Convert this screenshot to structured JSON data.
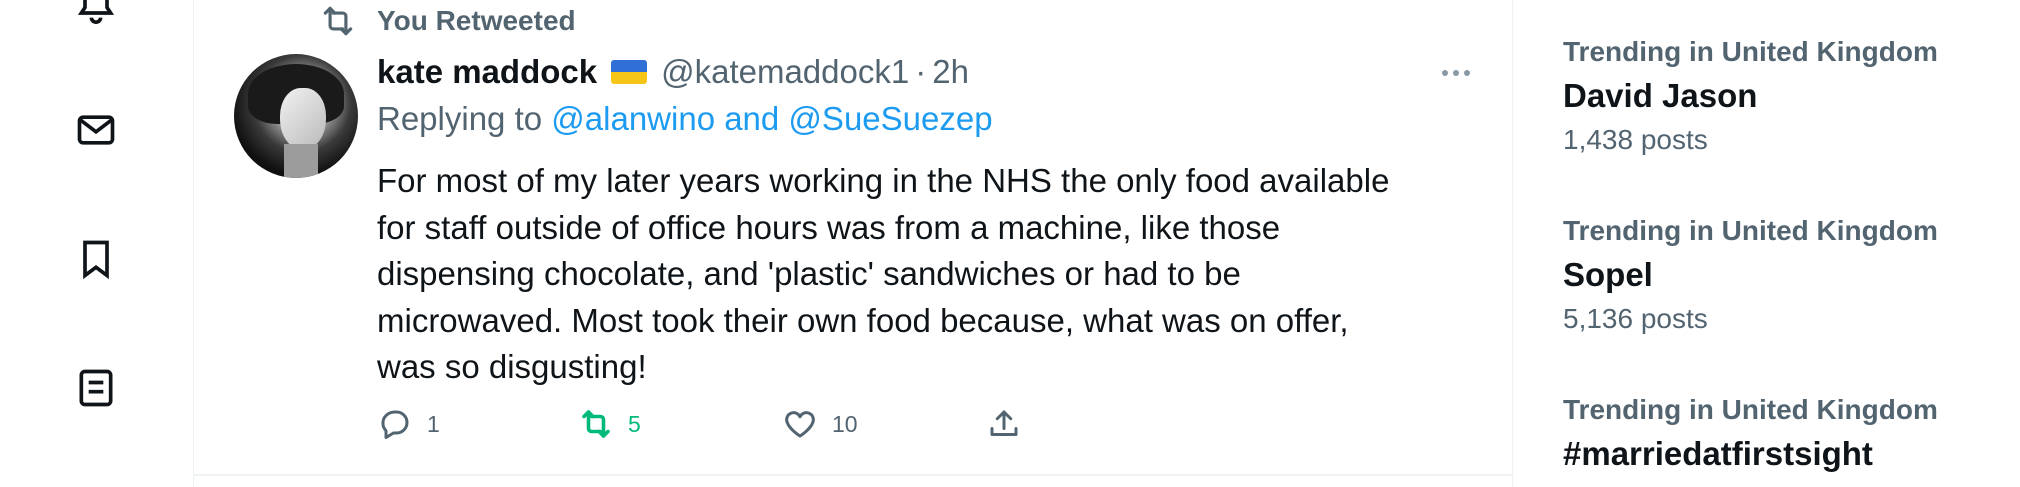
{
  "nav": {
    "icons": [
      "notifications-icon",
      "messages-icon",
      "bookmarks-icon",
      "lists-icon"
    ]
  },
  "tweet": {
    "social_context": "You Retweeted",
    "author_name": "kate maddock",
    "author_flag": "ukraine-flag",
    "handle": "@katemaddock1",
    "separator": "·",
    "time": "2h",
    "replying_prefix": "Replying to",
    "replying_to": "@alanwino and @SueSuezep",
    "text_lines": [
      "For most of my later years working in the NHS the only food available",
      "for staff outside of office hours was from a machine, like those",
      "dispensing chocolate, and 'plastic' sandwiches or had to be",
      "microwaved. Most took their own food because, what was on offer,",
      "was so disgusting!"
    ],
    "actions": {
      "reply_count": "1",
      "retweet_count": "5",
      "like_count": "10"
    },
    "colors": {
      "retweet_active": "#00ba7c",
      "link": "#1d9bf0",
      "secondary_text": "#536471"
    }
  },
  "trends": [
    {
      "context": "Trending in United Kingdom",
      "name": "David Jason",
      "count": "1,438 posts"
    },
    {
      "context": "Trending in United Kingdom",
      "name": "Sopel",
      "count": "5,136 posts"
    },
    {
      "context": "Trending in United Kingdom",
      "name": "#marriedatfirstsight",
      "count": ""
    }
  ]
}
